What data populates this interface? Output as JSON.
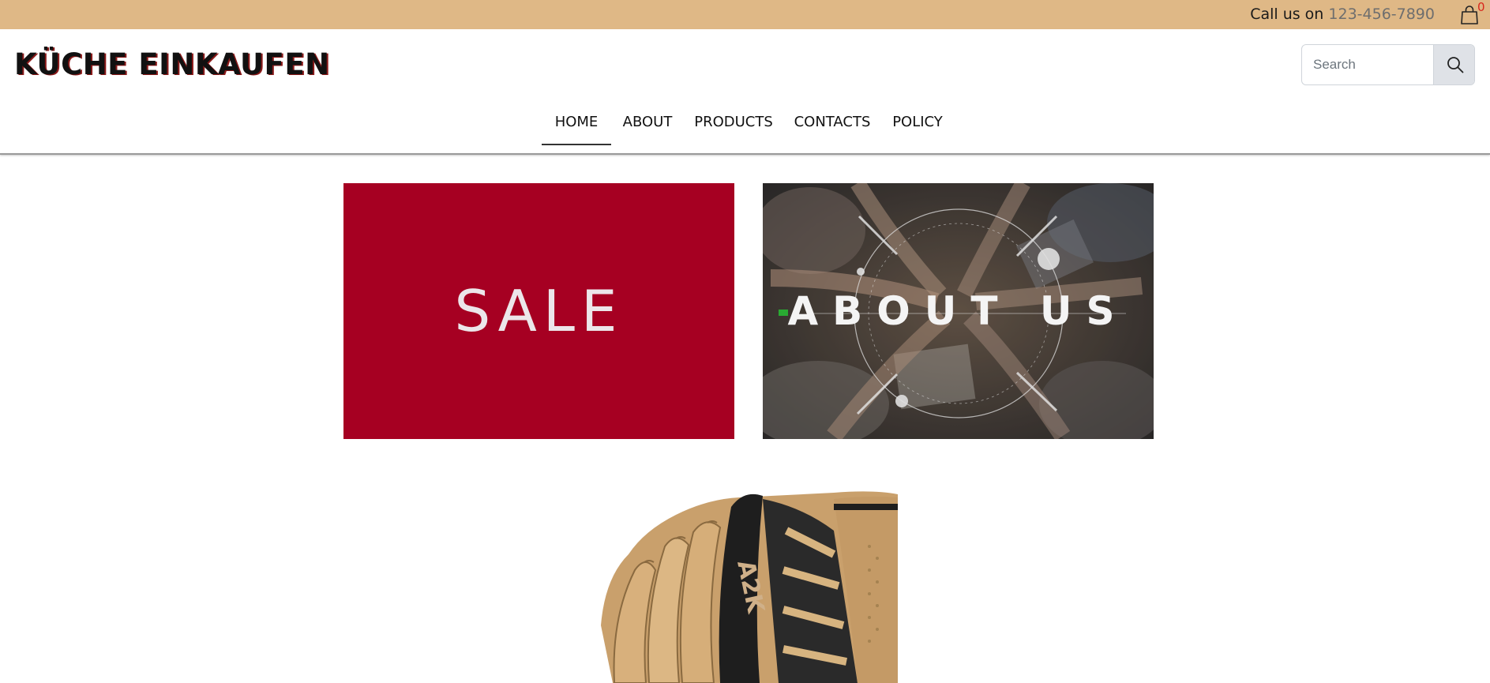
{
  "topbar": {
    "call_label": "Call us on",
    "phone": "123-456-7890",
    "cart_icon": "shopping-bag-icon",
    "cart_count": "0"
  },
  "header": {
    "logo": "KÜCHE EINKAUFEN",
    "search_placeholder": "Search",
    "search_icon": "search-icon"
  },
  "nav": {
    "items": [
      {
        "label": "HOME",
        "active": true
      },
      {
        "label": "ABOUT",
        "active": false
      },
      {
        "label": "PRODUCTS",
        "active": false
      },
      {
        "label": "CONTACTS",
        "active": false
      },
      {
        "label": "POLICY",
        "active": false
      }
    ]
  },
  "banners": {
    "sale_text": "SALE",
    "about_text": "ABOUT US"
  },
  "colors": {
    "topbar": "#dfb886",
    "sale_bg": "#a60022",
    "phone_text": "#6e6e6e",
    "cart_count": "#d9261c"
  }
}
